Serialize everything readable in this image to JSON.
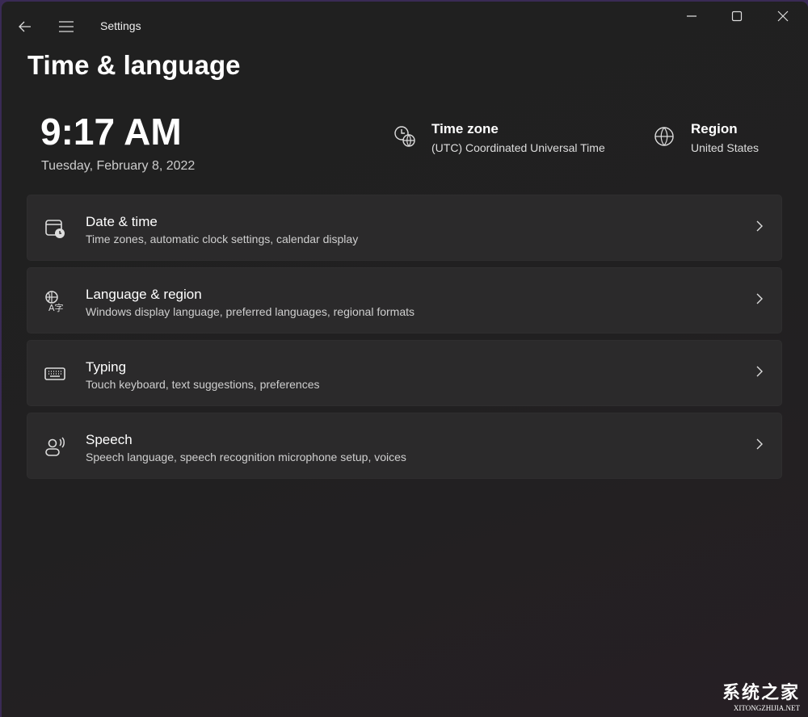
{
  "titlebar": {
    "title": "Settings"
  },
  "page": {
    "title": "Time & language"
  },
  "clock": {
    "time": "9:17 AM",
    "date": "Tuesday, February 8, 2022"
  },
  "timezone": {
    "label": "Time zone",
    "value": "(UTC) Coordinated Universal Time"
  },
  "region": {
    "label": "Region",
    "value": "United States"
  },
  "items": [
    {
      "title": "Date & time",
      "subtitle": "Time zones, automatic clock settings, calendar display",
      "icon": "calendar-clock-icon"
    },
    {
      "title": "Language & region",
      "subtitle": "Windows display language, preferred languages, regional formats",
      "icon": "language-icon"
    },
    {
      "title": "Typing",
      "subtitle": "Touch keyboard, text suggestions, preferences",
      "icon": "keyboard-icon"
    },
    {
      "title": "Speech",
      "subtitle": "Speech language, speech recognition microphone setup, voices",
      "icon": "speech-icon"
    }
  ],
  "watermark": {
    "text": "系统之家",
    "url_text": "XITONGZHIJIA.NET"
  }
}
